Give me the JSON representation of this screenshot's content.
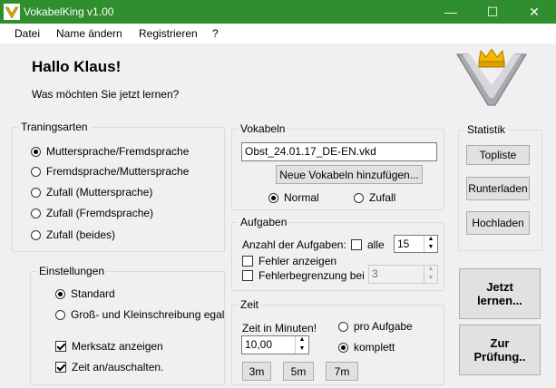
{
  "window": {
    "title": "VokabelKing v1.00",
    "minimize_glyph": "—",
    "maximize_glyph": "☐",
    "close_glyph": "✕"
  },
  "menu": [
    "Datei",
    "Name ändern",
    "Registrieren",
    "?"
  ],
  "greeting": "Hallo Klaus!",
  "question": "Was möchten Sie jetzt lernen?",
  "logo_icon": "crown-v-logo-icon",
  "trainingsarten": {
    "legend": "Traningsarten",
    "options": [
      {
        "label": "Muttersprache/Fremdsprache",
        "selected": true
      },
      {
        "label": "Fremdsprache/Muttersprache",
        "selected": false
      },
      {
        "label": "Zufall (Muttersprache)",
        "selected": false
      },
      {
        "label": "Zufall (Fremdsprache)",
        "selected": false
      },
      {
        "label": "Zufall (beides)",
        "selected": false
      }
    ]
  },
  "vokabeln": {
    "legend": "Vokabeln",
    "file": "Obst_24.01.17_DE-EN.vkd",
    "add_button": "Neue Vokabeln hinzufügen...",
    "mode_normal": "Normal",
    "mode_zufall": "Zufall",
    "normal_selected": true
  },
  "statistik": {
    "legend": "Statistik",
    "topliste": "Topliste",
    "runterladen": "Runterladen",
    "hochladen": "Hochladen"
  },
  "aufgaben": {
    "legend": "Aufgaben",
    "anzahl_label": "Anzahl der Aufgaben:",
    "alle_label": "alle",
    "alle_checked": false,
    "anzahl_value": "15",
    "fehler_label": "Fehler anzeigen",
    "fehler_checked": false,
    "begrenzung_label": "Fehlerbegrenzung bei",
    "begrenzung_checked": false,
    "begrenzung_value": "3"
  },
  "einstellungen": {
    "legend": "Einstellungen",
    "standard": "Standard",
    "standard_selected": true,
    "gross_klein": "Groß- und Kleinschreibung egal",
    "merksatz": "Merksatz anzeigen",
    "merksatz_checked": true,
    "zeit_toggle": "Zeit an/auschalten.",
    "zeit_checked": true
  },
  "zeit": {
    "legend": "Zeit",
    "minuten_label": "Zeit in Minuten!",
    "minuten_value": "10,00",
    "pro_aufgabe": "pro Aufgabe",
    "komplett": "komplett",
    "komplett_selected": true,
    "preset_3": "3m",
    "preset_5": "5m",
    "preset_7": "7m"
  },
  "actions": {
    "jetzt_lernen": "Jetzt lernen...",
    "zur_pruefung": "Zur Prüfung.."
  },
  "colors": {
    "titlebar": "#2f8f2f",
    "logo_gold": "#f0b800",
    "logo_silver": "#a0a0a8"
  }
}
